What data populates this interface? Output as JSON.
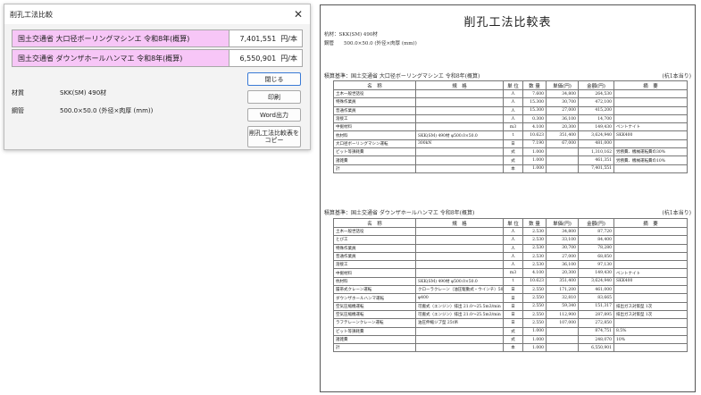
{
  "dialog": {
    "title": "削孔工法比較",
    "methods": [
      {
        "name": "国土交通省 大口径ボーリングマシンエ 令和8年(概算)",
        "price": "7,401,551",
        "unit": "円/本"
      },
      {
        "name": "国土交通省 ダウンザホールハンマエ 令和8年(概算)",
        "price": "6,550,901",
        "unit": "円/本"
      }
    ],
    "buttons": {
      "close": "閉じる",
      "print": "印刷",
      "word": "Word出力",
      "copy": "削孔工法比較表をコピー"
    },
    "fields": {
      "material_label": "材質",
      "material_value": "SKK(SM) 490材",
      "pipe_label": "鋼管",
      "pipe_value": "500.0×50.0 (外径×肉厚 (mm))"
    }
  },
  "document": {
    "title": "削孔工法比較表",
    "info_line1": "杭材：SKK(SM) 490材",
    "info_line2": "鋼管　　500.0×50.0 (外径×肉厚 (mm))",
    "headers": [
      "名　称",
      "規　格",
      "単 位",
      "数 量",
      "単価(円)",
      "金額(円)",
      "摘　要"
    ],
    "section1": {
      "title": "積算基準：国土交通省 大口径ボーリングマシンエ 令和8年(概算)",
      "note": "(杭1本当り)",
      "rows": [
        [
          "土木一般世話役",
          "",
          "人",
          "7.600",
          "34,800",
          "264,530",
          ""
        ],
        [
          "特殊作業員",
          "",
          "人",
          "15.300",
          "30,700",
          "472,100",
          ""
        ],
        [
          "普通作業員",
          "",
          "人",
          "15.300",
          "27,000",
          "415,200",
          ""
        ],
        [
          "溶接工",
          "",
          "人",
          "0.300",
          "36,100",
          "14,700",
          ""
        ],
        [
          "中掘材料",
          "",
          "m3",
          "4.100",
          "20,300",
          "149,430",
          "ベントナイト"
        ],
        [
          "杭材料",
          "SKK(SM) 490材 φ500.0×50.0",
          "t",
          "10.623",
          "351,400",
          "3,624,940",
          "SKK400"
        ],
        [
          "大口径ボーリングマシン運転",
          "300kN",
          "日",
          "7.190",
          "67,000",
          "481,000",
          ""
        ],
        [
          "ビット等損耗費",
          "",
          "式",
          "1.000",
          "",
          "1,310,162",
          "労務費、機械運転費の30%"
        ],
        [
          "諸雑費",
          "",
          "式",
          "1.000",
          "",
          "461,351",
          "労務費、機械運転費の10%"
        ],
        [
          "計",
          "",
          "本",
          "1.000",
          "",
          "7,401,551",
          ""
        ]
      ]
    },
    "section2": {
      "title": "積算基準：国土交通省 ダウンザホールハンマエ 令和8年(概算)",
      "note": "(杭1本当り)",
      "rows": [
        [
          "土木一般世話役",
          "",
          "人",
          "2.530",
          "34,800",
          "87,720",
          ""
        ],
        [
          "とび工",
          "",
          "人",
          "2.530",
          "33,100",
          "84,400",
          ""
        ],
        [
          "特殊作業員",
          "",
          "人",
          "2.530",
          "30,700",
          "78,280",
          ""
        ],
        [
          "普通作業員",
          "",
          "人",
          "2.530",
          "27,000",
          "68,850",
          ""
        ],
        [
          "溶接工",
          "",
          "人",
          "2.530",
          "36,100",
          "97,130",
          ""
        ],
        [
          "中掘材料",
          "",
          "m3",
          "4.100",
          "20,300",
          "149,430",
          "ベントナイト"
        ],
        [
          "杭材料",
          "SKK(SM) 490材 φ500.0×50.0",
          "t",
          "10.623",
          "351,400",
          "3,624,940",
          "SKK400"
        ],
        [
          "履帯式クレーン運転",
          "クローラクレーン（油圧駆動式・ウインチ）50t吊",
          "日",
          "2.550",
          "171,200",
          "461,000",
          ""
        ],
        [
          "ダウンザホールハンマ運転",
          "φ400",
          "日",
          "2.550",
          "32,810",
          "83,665",
          ""
        ],
        [
          "空気圧縮機運転",
          "可搬式（エンジン）排出 21.0～25.5m3/min",
          "日",
          "2.550",
          "59,340",
          "151,317",
          "排出ガス対策型 1次"
        ],
        [
          "空気圧縮機運転",
          "可搬式（エンジン）排出 21.0～25.5m3/min",
          "日",
          "2.550",
          "112,900",
          "287,895",
          "排出ガス対策型 1次"
        ],
        [
          "ラフテレーンクレーン運転",
          "油圧伸縮ジブ型 25t吊",
          "日",
          "2.550",
          "107,000",
          "272,850",
          ""
        ],
        [
          "ビット等損耗費",
          "",
          "式",
          "1.000",
          "",
          "874,751",
          "8.5%"
        ],
        [
          "諸雑費",
          "",
          "式",
          "1.000",
          "",
          "248,070",
          "10%"
        ],
        [
          "計",
          "",
          "本",
          "1.000",
          "",
          "6,550,901",
          ""
        ]
      ]
    }
  }
}
